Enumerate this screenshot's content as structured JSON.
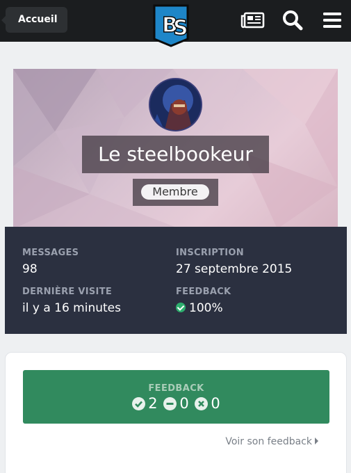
{
  "header": {
    "back_label": "Accueil",
    "logo_text": "BS"
  },
  "profile": {
    "username": "Le steelbookeur",
    "role": "Membre"
  },
  "stats": [
    {
      "label": "MESSAGES",
      "value": "98"
    },
    {
      "label": "INSCRIPTION",
      "value": "27 septembre 2015"
    },
    {
      "label": "DERNIÈRE VISITE",
      "value": "il y a 16 minutes"
    },
    {
      "label": "FEEDBACK",
      "value": "100%"
    }
  ],
  "feedback": {
    "title": "FEEDBACK",
    "positive": "2",
    "neutral": "0",
    "negative": "0",
    "link_label": "Voir son feedback"
  },
  "colors": {
    "topbar": "#1b1d1f",
    "stats_bg": "#2b3040",
    "feedback_green": "#318a5e",
    "check_green": "#2eae6e"
  }
}
